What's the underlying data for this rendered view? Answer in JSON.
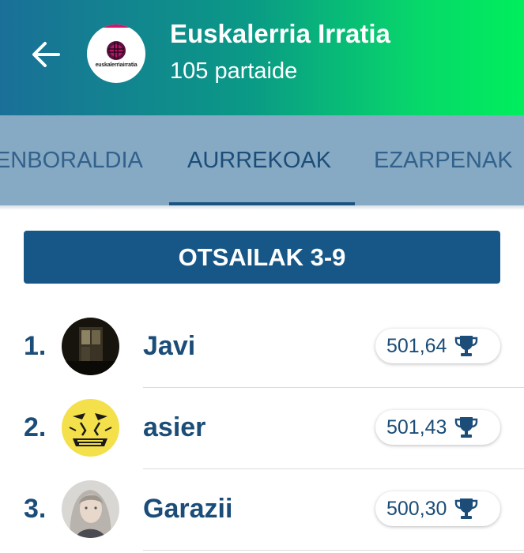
{
  "header": {
    "title": "Euskalerria Irratia",
    "subtitle": "105 partaide",
    "logo_text": "euskalerriairratia",
    "back_icon": "arrow-left-icon"
  },
  "tabs": [
    {
      "label": "DENBORALDIA",
      "active": false
    },
    {
      "label": "AURREKOAK",
      "active": true
    },
    {
      "label": "EZARPENAK",
      "active": false
    }
  ],
  "week_label": "OTSAILAK 3-9",
  "ranking": [
    {
      "rank": "1.",
      "name": "Javi",
      "score": "501,64",
      "icon": "trophy-icon"
    },
    {
      "rank": "2.",
      "name": "asier",
      "score": "501,43",
      "icon": "trophy-icon"
    },
    {
      "rank": "3.",
      "name": "Garazii",
      "score": "500,30",
      "icon": "trophy-icon"
    }
  ],
  "colors": {
    "primary": "#1b4d78",
    "banner": "#175787",
    "tab_bar": "#86a9c4",
    "gradient_start": "#1a6f98",
    "gradient_end": "#00ee5c"
  }
}
